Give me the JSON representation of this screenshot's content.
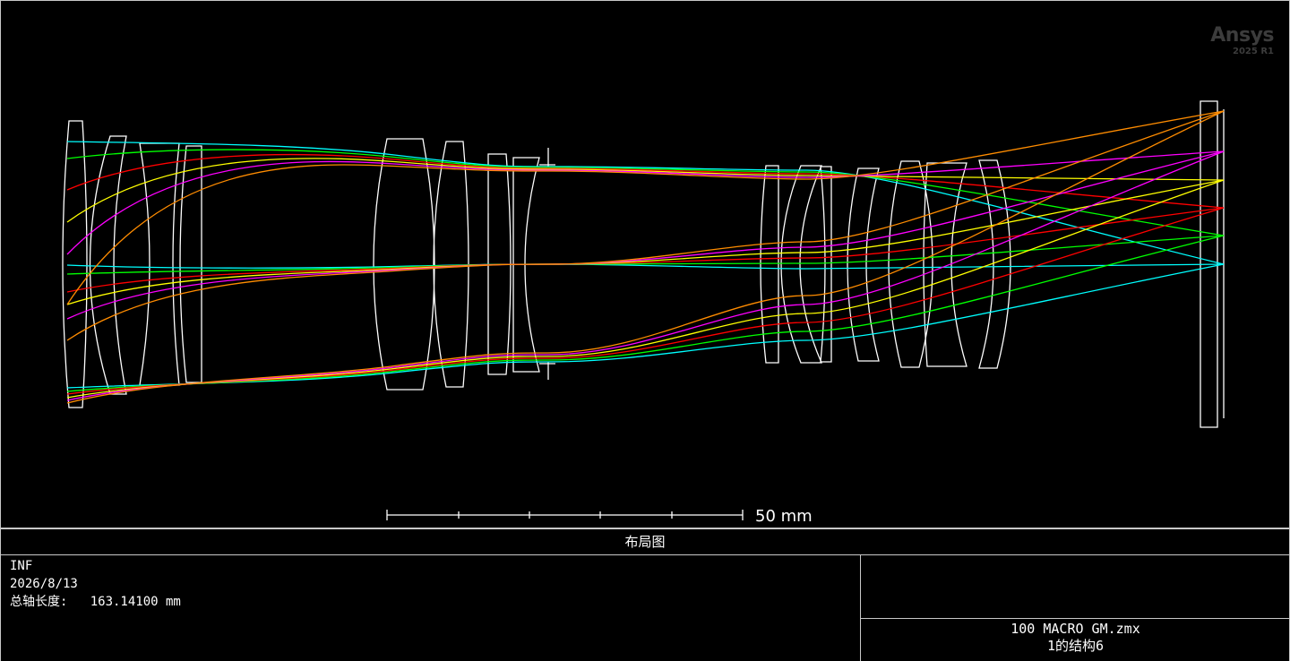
{
  "branding": {
    "name": "Ansys",
    "version": "2025 R1"
  },
  "scale_bar": {
    "label": "50 mm"
  },
  "plot_title": "布局图",
  "info": {
    "line1": "INF",
    "line2": "2026/8/13",
    "line3": "总轴长度:   163.14100 mm"
  },
  "file": {
    "name": "100 MACRO GM.zmx",
    "config": "1的结构6"
  },
  "colors": {
    "background": "#000000",
    "lens": "#ffffff",
    "rays": [
      "#00ffff",
      "#00ff00",
      "#ff0000",
      "#ffff00",
      "#ff00ff",
      "#ff8c00"
    ]
  }
}
